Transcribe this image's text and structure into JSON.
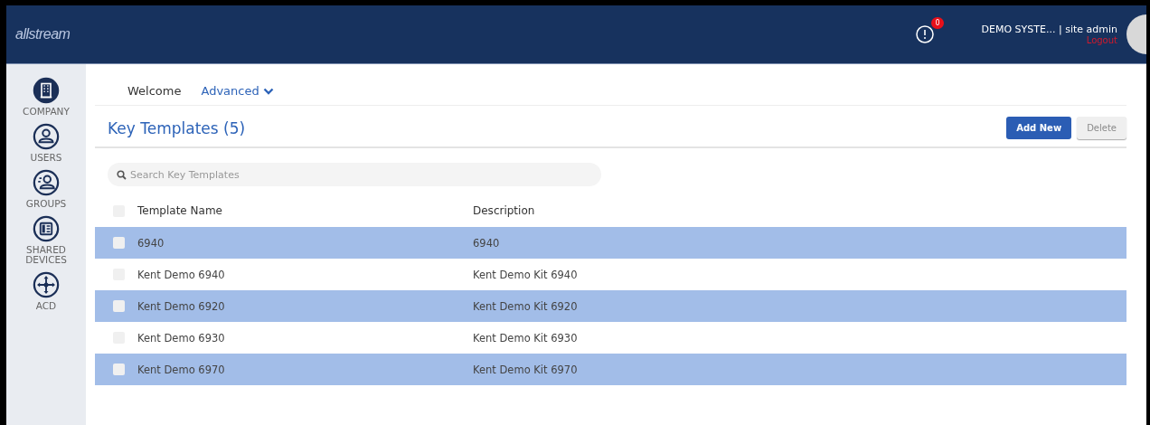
{
  "header": {
    "logo": "allstream",
    "notifications": {
      "count": "0"
    },
    "user": {
      "account": "DEMO SYSTE... | site admin",
      "logout": "Logout"
    }
  },
  "sidebar": {
    "items": [
      {
        "label": "COMPANY",
        "kind": "building"
      },
      {
        "label": "USERS",
        "kind": "user"
      },
      {
        "label": "GROUPS",
        "kind": "group"
      },
      {
        "label": "SHARED DEVICES",
        "kind": "device"
      },
      {
        "label": "ACD",
        "kind": "acd"
      }
    ]
  },
  "nav": [
    {
      "label": "Welcome",
      "kind": "link"
    },
    {
      "label": "Advanced",
      "kind": "dropdown"
    }
  ],
  "page": {
    "title": "Key Templates (5)",
    "buttons": [
      {
        "label": "Add New",
        "disabled": false
      },
      {
        "label": "Delete",
        "disabled": true
      }
    ]
  },
  "search": {
    "placeholder": "Search Key Templates"
  },
  "table": {
    "all_selected": false,
    "columns": [
      "Template Name",
      "Description"
    ],
    "rows": [
      {
        "cells": [
          "6940",
          "6940"
        ],
        "selected": true
      },
      {
        "cells": [
          "Kent Demo 6940",
          "Kent Demo Kit 6940"
        ],
        "selected": false
      },
      {
        "cells": [
          "Kent Demo 6920",
          "Kent Demo Kit 6920"
        ],
        "selected": true
      },
      {
        "cells": [
          "Kent Demo 6930",
          "Kent Demo Kit 6930"
        ],
        "selected": false
      },
      {
        "cells": [
          "Kent Demo 6970",
          "Kent Demo Kit 6970"
        ],
        "selected": true
      }
    ]
  }
}
